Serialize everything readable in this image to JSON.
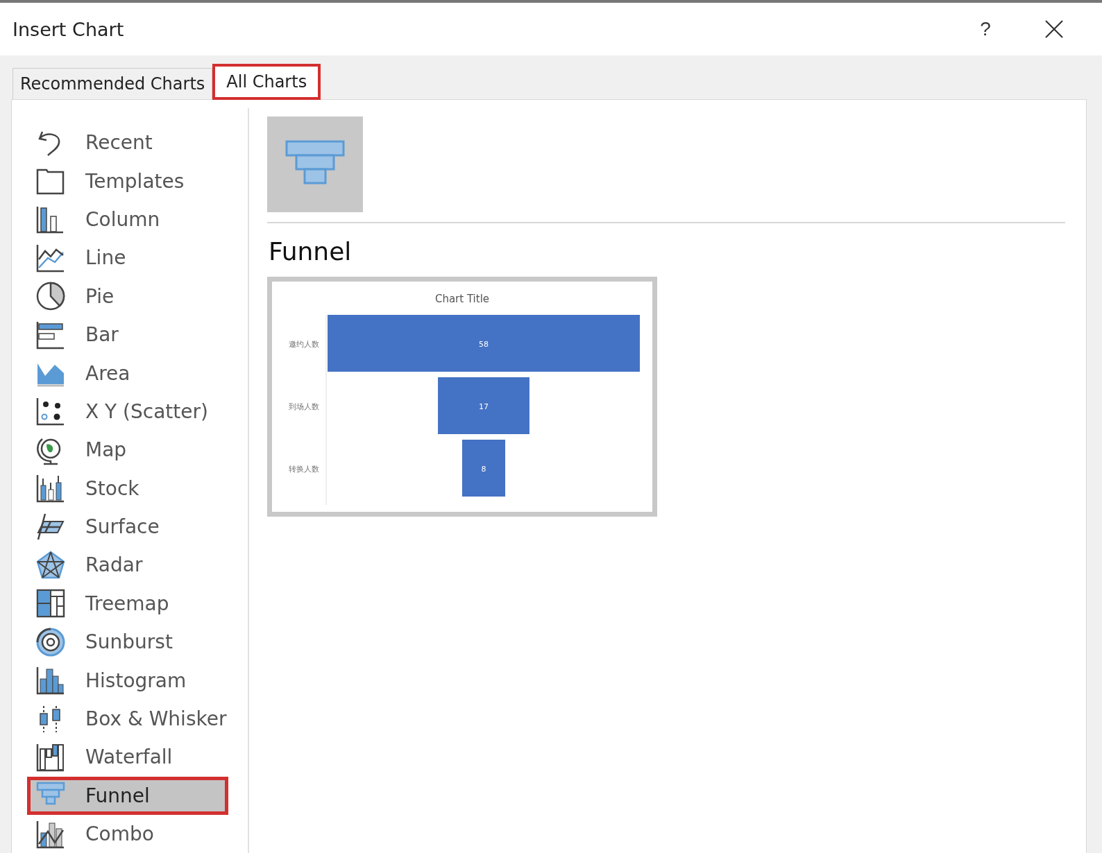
{
  "window": {
    "title": "Insert Chart",
    "help": "?"
  },
  "tabs": [
    {
      "label": "Recommended Charts",
      "selected": false
    },
    {
      "label": "All Charts",
      "selected": true
    }
  ],
  "chart_types": [
    {
      "label": "Recent",
      "selected": false
    },
    {
      "label": "Templates",
      "selected": false
    },
    {
      "label": "Column",
      "selected": false
    },
    {
      "label": "Line",
      "selected": false
    },
    {
      "label": "Pie",
      "selected": false
    },
    {
      "label": "Bar",
      "selected": false
    },
    {
      "label": "Area",
      "selected": false
    },
    {
      "label": "X Y (Scatter)",
      "selected": false
    },
    {
      "label": "Map",
      "selected": false
    },
    {
      "label": "Stock",
      "selected": false
    },
    {
      "label": "Surface",
      "selected": false
    },
    {
      "label": "Radar",
      "selected": false
    },
    {
      "label": "Treemap",
      "selected": false
    },
    {
      "label": "Sunburst",
      "selected": false
    },
    {
      "label": "Histogram",
      "selected": false
    },
    {
      "label": "Box & Whisker",
      "selected": false
    },
    {
      "label": "Waterfall",
      "selected": false
    },
    {
      "label": "Funnel",
      "selected": true
    },
    {
      "label": "Combo",
      "selected": false
    }
  ],
  "detail": {
    "heading": "Funnel",
    "preview": {
      "title": "Chart Title",
      "stages": [
        {
          "label": "邀约人数",
          "value": "58"
        },
        {
          "label": "到场人数",
          "value": "17"
        },
        {
          "label": "转换人数",
          "value": "8"
        }
      ]
    }
  }
}
